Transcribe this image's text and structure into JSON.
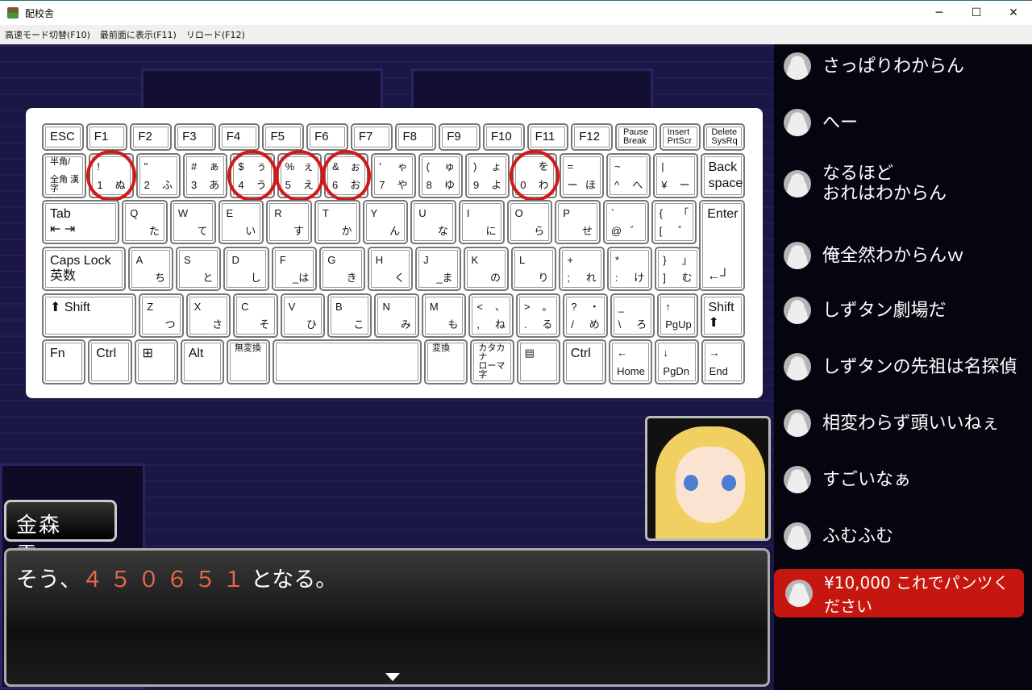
{
  "window": {
    "title": "配校舎",
    "minimize": "─",
    "maximize": "☐",
    "close": "✕"
  },
  "menu": [
    "高速モード切替(F10)",
    "最前面に表示(F11)",
    "リロード(F12)"
  ],
  "keyboard": {
    "rows": [
      [
        {
          "tl": "ESC"
        },
        {
          "tl": "F1"
        },
        {
          "tl": "F2"
        },
        {
          "tl": "F3"
        },
        {
          "tl": "F4"
        },
        {
          "tl": "F5"
        },
        {
          "tl": "F6"
        },
        {
          "tl": "F7"
        },
        {
          "tl": "F8"
        },
        {
          "tl": "F9"
        },
        {
          "tl": "F10"
        },
        {
          "tl": "F11"
        },
        {
          "tl": "F12"
        },
        {
          "tl": "Pause",
          "bl": "Break",
          "small": true
        },
        {
          "tl": "Insert",
          "bl": "PrtScr",
          "small": true
        },
        {
          "tl": "Delete",
          "bl": "SysRq",
          "small": true
        }
      ],
      [
        {
          "tl": "半角/",
          "bl": "全角 漢字",
          "small": true
        },
        {
          "tl": "!",
          "bl": "1",
          "br": "ぬ",
          "circled": true
        },
        {
          "tl": "\"",
          "bl": "2",
          "br": "ふ"
        },
        {
          "tl": "#",
          "tr": "ぁ",
          "bl": "3",
          "br": "あ"
        },
        {
          "tl": "$",
          "tr": "ぅ",
          "bl": "4",
          "br": "う",
          "circled": true
        },
        {
          "tl": "%",
          "tr": "ぇ",
          "bl": "5",
          "br": "え",
          "circled": true
        },
        {
          "tl": "&",
          "tr": "ぉ",
          "bl": "6",
          "br": "お",
          "circled": true
        },
        {
          "tl": "'",
          "tr": "ゃ",
          "bl": "7",
          "br": "や"
        },
        {
          "tl": "(",
          "tr": "ゅ",
          "bl": "8",
          "br": "ゆ"
        },
        {
          "tl": ")",
          "tr": "ょ",
          "bl": "9",
          "br": "よ"
        },
        {
          "tr": "を",
          "bl": "0",
          "br": "わ",
          "circled": true
        },
        {
          "tl": "=",
          "bl": "ー",
          "br": "ほ"
        },
        {
          "tl": "~",
          "bl": "^",
          "br": "へ"
        },
        {
          "tl": "|",
          "bl": "¥",
          "br": "ー"
        },
        {
          "tl": "Back",
          "bl": "space",
          "big": true
        }
      ],
      [
        {
          "tl": "Tab",
          "bl": "⇤ ⇥",
          "w": 1.75,
          "big": true
        },
        {
          "tl": "Q",
          "br": "た"
        },
        {
          "tl": "W",
          "br": "て"
        },
        {
          "tl": "E",
          "br": "い"
        },
        {
          "tl": "R",
          "br": "す"
        },
        {
          "tl": "T",
          "br": "か"
        },
        {
          "tl": "Y",
          "br": "ん"
        },
        {
          "tl": "U",
          "br": "な"
        },
        {
          "tl": "I",
          "br": "に"
        },
        {
          "tl": "O",
          "br": "ら"
        },
        {
          "tl": "P",
          "br": "せ"
        },
        {
          "tl": "`",
          "bl": "@",
          "br": "゛"
        },
        {
          "tl": "{",
          "tr": "「",
          "bl": "[",
          "br": "゜"
        },
        {
          "tl": "Enter",
          "bl": "←┘",
          "tall": true,
          "big": true
        }
      ],
      [
        {
          "tl": "Caps Lock",
          "bl": "英数",
          "w": 1.9,
          "big": true
        },
        {
          "tl": "A",
          "br": "ち"
        },
        {
          "tl": "S",
          "br": "と"
        },
        {
          "tl": "D",
          "br": "し"
        },
        {
          "tl": "F",
          "br": "_は"
        },
        {
          "tl": "G",
          "br": "き"
        },
        {
          "tl": "H",
          "br": "く"
        },
        {
          "tl": "J",
          "br": "_ま"
        },
        {
          "tl": "K",
          "br": "の"
        },
        {
          "tl": "L",
          "br": "り"
        },
        {
          "tl": "+",
          "bl": ";",
          "br": "れ"
        },
        {
          "tl": "*",
          "bl": ":",
          "br": "け"
        },
        {
          "tl": "}",
          "tr": "」",
          "bl": "]",
          "br": "む"
        },
        {
          "spacer": true
        }
      ],
      [
        {
          "tl": "⬆ Shift",
          "w": 2.2,
          "big": true
        },
        {
          "tl": "Z",
          "br": "つ"
        },
        {
          "tl": "X",
          "br": "さ"
        },
        {
          "tl": "C",
          "br": "そ"
        },
        {
          "tl": "V",
          "br": "ひ"
        },
        {
          "tl": "B",
          "br": "こ"
        },
        {
          "tl": "N",
          "br": "み"
        },
        {
          "tl": "M",
          "br": "も"
        },
        {
          "tl": "<",
          "tr": "、",
          "bl": ",",
          "br": "ね"
        },
        {
          "tl": ">",
          "tr": "。",
          "bl": ".",
          "br": "る"
        },
        {
          "tl": "?",
          "tr": "・",
          "bl": "/",
          "br": "め"
        },
        {
          "tl": "_",
          "bl": "\\",
          "br": "ろ"
        },
        {
          "tl": "↑",
          "bl": "PgUp",
          "w": 0.9
        },
        {
          "tl": "Shift",
          "bl": "⬆",
          "big": true
        }
      ],
      [
        {
          "tl": "Fn",
          "big": true
        },
        {
          "tl": "Ctrl",
          "big": true
        },
        {
          "tl": "⊞",
          "big": true
        },
        {
          "tl": "Alt",
          "big": true
        },
        {
          "tl": "無変換",
          "small": true
        },
        {
          "tl": "",
          "w": 3.6
        },
        {
          "tl": "変換",
          "small": true
        },
        {
          "tl": "カタカナ",
          "bl": "ローマ字",
          "small": true
        },
        {
          "tl": "▤"
        },
        {
          "tl": "Ctrl",
          "big": true
        },
        {
          "tl": "←",
          "bl": "Home"
        },
        {
          "tl": "↓",
          "bl": "PgDn"
        },
        {
          "tl": "→",
          "bl": "End"
        }
      ]
    ]
  },
  "speaker": "金森　雫",
  "dialog": {
    "pre": "そう、",
    "num": "４５０６５１",
    "post": "となる。"
  },
  "chat": [
    {
      "text": "さっぱりわからん"
    },
    {
      "text": "へー"
    },
    {
      "text": "なるほど\nおれはわからん"
    },
    {
      "text": "俺全然わからんｗ"
    },
    {
      "text": "しずタン劇場だ"
    },
    {
      "text": "しずタンの先祖は名探偵"
    },
    {
      "text": "相変わらず頭いいねぇ"
    },
    {
      "text": "すごいなぁ"
    },
    {
      "text": "ふむふむ"
    }
  ],
  "superchat": {
    "text": "¥10,000 これでパンツください",
    "color": "#c5170f"
  },
  "colors": {
    "highlight": "#d21818",
    "number": "#e8694a"
  }
}
